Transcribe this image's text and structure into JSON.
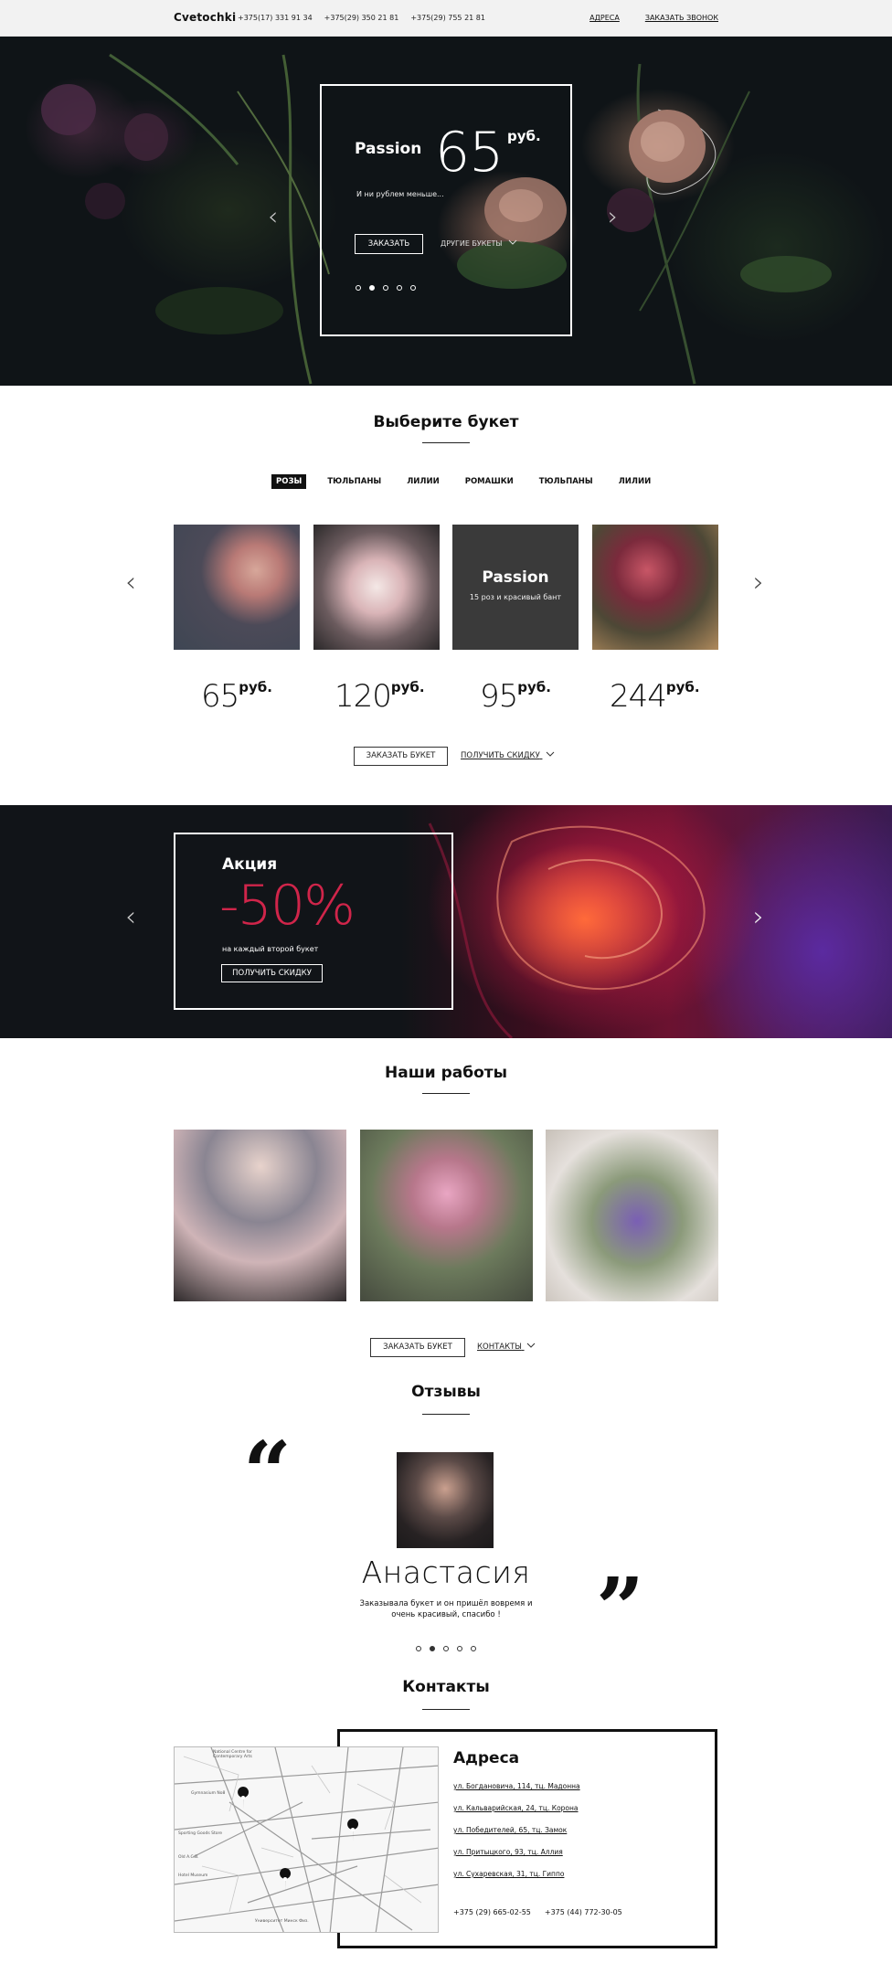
{
  "header": {
    "brand": "Cvetochki",
    "phones": [
      "+375(17) 331 91 34",
      "+375(29) 350 21 81",
      "+375(29) 755 21 81"
    ],
    "links": [
      "АДРЕСА",
      "ЗАКАЗАТЬ ЗВОНОК"
    ]
  },
  "hero": {
    "title": "Passion",
    "price": "65",
    "currency": "руб.",
    "subtitle": "И ни рублем меньше...",
    "order_button": "ЗАКАЗАТЬ",
    "more_link": "ДРУГИЕ БУКЕТЫ",
    "slides_total": 5,
    "slide_active": 2
  },
  "bouquets": {
    "title": "Выберите букет",
    "tabs": [
      "РОЗЫ",
      "ТЮЛЬПАНЫ",
      "ЛИЛИИ",
      "РОМАШКИ",
      "ТЮЛЬПАНЫ",
      "ЛИЛИИ"
    ],
    "active_tab": 0,
    "featured_title": "Passion",
    "featured_subtitle": "15 роз и красивый бант",
    "prices": [
      "65",
      "120",
      "95",
      "244"
    ],
    "currency": "руб.",
    "order_button": "ЗАКАЗАТЬ БУКЕТ",
    "discount_link": "ПОЛУЧИТЬ СКИДКУ"
  },
  "promo": {
    "title": "Акция",
    "discount": "-50%",
    "subtitle": "на каждый второй букет",
    "button": "ПОЛУЧИТЬ СКИДКУ"
  },
  "works": {
    "title": "Наши работы",
    "order_button": "ЗАКАЗАТЬ БУКЕТ",
    "contacts_link": "КОНТАКТЫ"
  },
  "reviews": {
    "title": "Отзывы",
    "name": "Анастасия",
    "text": "Заказывала букет и он пришёл вовремя и очень красивый, спасибо !",
    "slides_total": 5,
    "slide_active": 2
  },
  "contacts": {
    "title": "Контакты",
    "heading": "Адреса",
    "addresses": [
      "ул. Богдановича, 114, тц. Мадонна",
      "ул. Кальварийская, 24, тц. Корона",
      "ул. Победителей, 65, тц. Замок",
      "ул. Притыцкого, 93, тц. Аллия",
      "ул. Сухаревская, 31, тц. Гиппо"
    ],
    "phones": [
      "+375 (29) 665-02-55",
      "+375 (44) 772-30-05"
    ],
    "map_labels": [
      "National Centre for Contemporary Arts",
      "Gymnasium No8",
      "Sporting Goods Store",
      "Оld A.C.B.",
      "Hotel Museum",
      "Университет Минск Физ."
    ]
  },
  "colors": {
    "accent": "#d0254a",
    "dark": "#111111",
    "topbar": "#f2f2f2"
  }
}
